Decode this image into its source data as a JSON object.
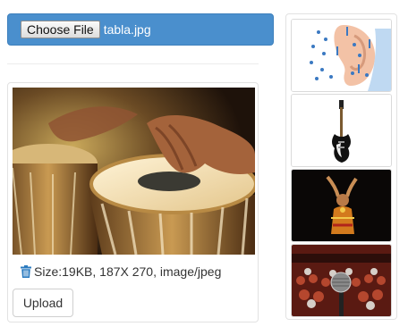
{
  "file_input": {
    "choose_label": "Choose File",
    "file_name": "tabla.jpg"
  },
  "preview": {
    "image_alt": "tabla drums being played",
    "file_info": "Size:19KB, 187X 270, image/jpeg",
    "upload_label": "Upload"
  },
  "thumbnails": [
    {
      "name": "acupuncture-ear-chart"
    },
    {
      "name": "electric-guitar"
    },
    {
      "name": "classical-dancer"
    },
    {
      "name": "microphone-audience"
    }
  ],
  "colors": {
    "accent": "#4a8fcd",
    "trash_icon": "#2a7abf"
  }
}
